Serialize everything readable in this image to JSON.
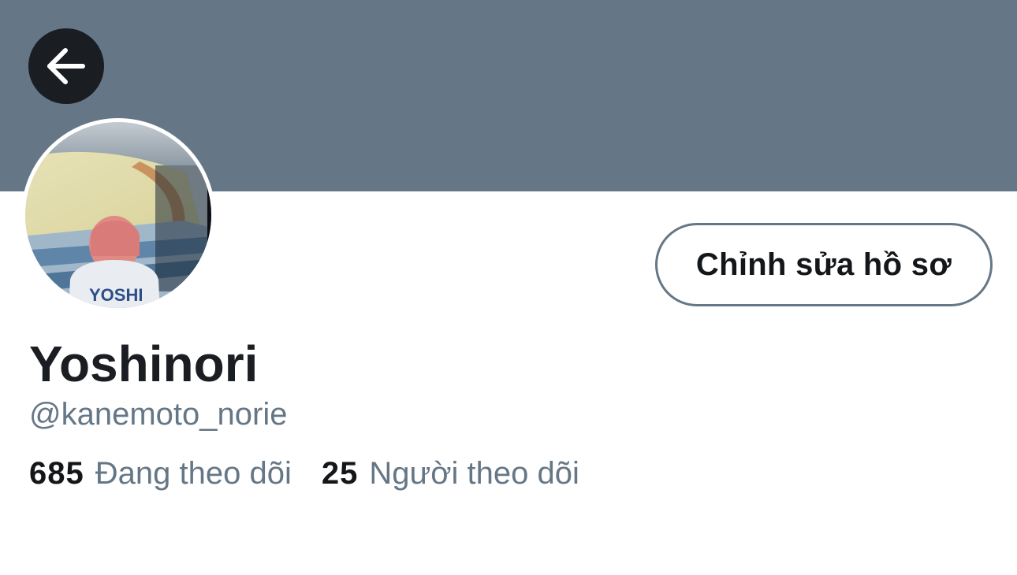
{
  "header": {
    "banner_color": "#657786",
    "back_icon": "arrow-left-icon"
  },
  "profile": {
    "avatar_description": "photo of person with pink hair in YOSHI jersey at baseball stadium",
    "avatar_jersey_text": "YOSHI",
    "display_name": "Yoshinori",
    "handle": "@kanemoto_norie",
    "edit_button_label": "Chỉnh sửa hồ sơ"
  },
  "stats": {
    "following_count": "685",
    "following_label": "Đang theo dõi",
    "followers_count": "25",
    "followers_label": "Người theo dõi"
  },
  "colors": {
    "text_primary": "#14171a",
    "text_secondary": "#657786",
    "button_border": "#657786"
  }
}
